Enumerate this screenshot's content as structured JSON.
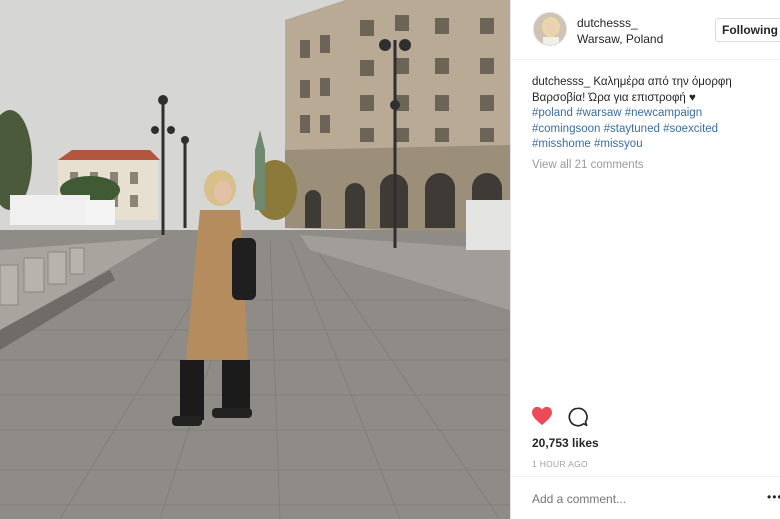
{
  "post": {
    "username": "dutchesss_",
    "location": "Warsaw, Poland",
    "follow_label": "Following",
    "caption": {
      "user": "dutchesss_",
      "text": "Καλημέρα από την όμορφη Βαρσοβία! Ώρα για επιστροφή",
      "heart": "♥",
      "hashtags": [
        "#poland",
        "#warsaw",
        "#newcampaign",
        "#comingsoon",
        "#staytuned",
        "#soexcited",
        "#misshome",
        "#missyou"
      ]
    },
    "view_all": "View all 21 comments",
    "likes": "20,753 likes",
    "time": "1 HOUR AGO",
    "comment_placeholder": "Add a comment...",
    "more_label": "•••",
    "colors": {
      "like_heart": "#ed4956",
      "hashtag": "#3a6ea5"
    }
  },
  "icons": {
    "like": "heart-icon",
    "comment": "comment-icon"
  }
}
